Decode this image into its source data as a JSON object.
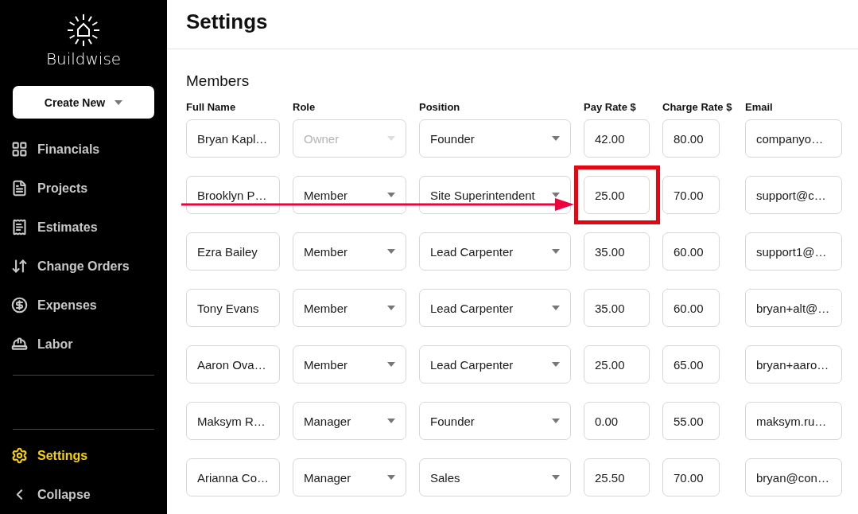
{
  "sidebar": {
    "brand": "Buildwise",
    "create_button": "Create New",
    "items": [
      {
        "kind": "financials",
        "label": "Financials",
        "selected": false
      },
      {
        "kind": "projects",
        "label": "Projects",
        "selected": false
      },
      {
        "kind": "estimates",
        "label": "Estimates",
        "selected": false
      },
      {
        "kind": "change_orders",
        "label": "Change Orders",
        "selected": false
      },
      {
        "kind": "expenses",
        "label": "Expenses",
        "selected": false
      },
      {
        "kind": "labor",
        "label": "Labor",
        "selected": false
      }
    ],
    "bottom_items": [
      {
        "kind": "settings",
        "label": "Settings",
        "selected": true
      },
      {
        "kind": "collapse",
        "label": "Collapse",
        "selected": false
      }
    ]
  },
  "page": {
    "title": "Settings"
  },
  "members": {
    "title": "Members",
    "columns": [
      "Full Name",
      "Role",
      "Position",
      "Pay Rate $",
      "Charge Rate $",
      "Email"
    ],
    "rows": [
      {
        "name": "Bryan Kapl…",
        "role": "Owner",
        "role_disabled": true,
        "position": "Founder",
        "pay_rate": "42.00",
        "charge_rate": "80.00",
        "email": "companyo…",
        "annotated": false
      },
      {
        "name": "Brooklyn P…",
        "role": "Member",
        "role_disabled": false,
        "position": "Site Superintendent",
        "pay_rate": "25.00",
        "charge_rate": "70.00",
        "email": "support@c…",
        "annotated": true
      },
      {
        "name": "Ezra Bailey",
        "role": "Member",
        "role_disabled": false,
        "position": "Lead Carpenter",
        "pay_rate": "35.00",
        "charge_rate": "60.00",
        "email": "support1@…",
        "annotated": false
      },
      {
        "name": "Tony Evans",
        "role": "Member",
        "role_disabled": false,
        "position": "Lead Carpenter",
        "pay_rate": "35.00",
        "charge_rate": "60.00",
        "email": "bryan+alt@…",
        "annotated": false
      },
      {
        "name": "Aaron Ova…",
        "role": "Member",
        "role_disabled": false,
        "position": "Lead Carpenter",
        "pay_rate": "25.00",
        "charge_rate": "65.00",
        "email": "bryan+aaro…",
        "annotated": false
      },
      {
        "name": "Maksym R…",
        "role": "Manager",
        "role_disabled": false,
        "position": "Founder",
        "pay_rate": "0.00",
        "charge_rate": "55.00",
        "email": "maksym.ru…",
        "annotated": false
      },
      {
        "name": "Arianna Co…",
        "role": "Manager",
        "role_disabled": false,
        "position": "Sales",
        "pay_rate": "25.50",
        "charge_rate": "70.00",
        "email": "bryan@con…",
        "annotated": false
      }
    ]
  }
}
